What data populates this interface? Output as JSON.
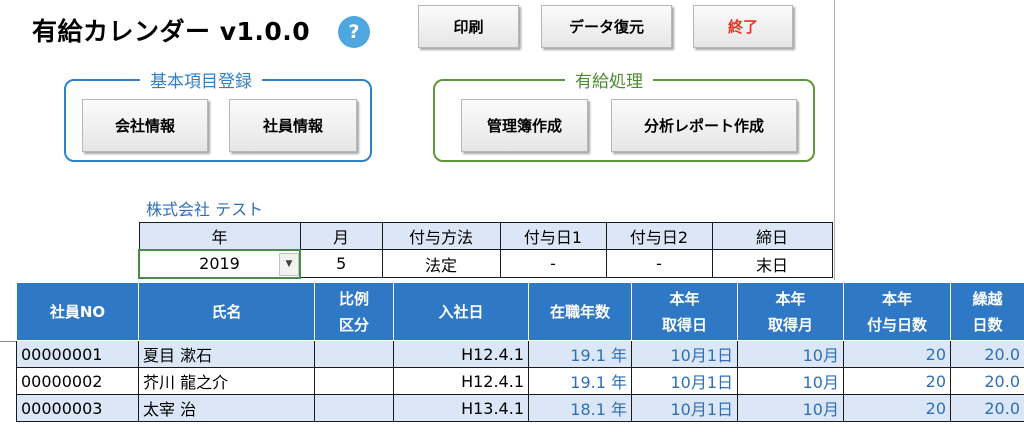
{
  "app": {
    "title": "有給カレンダー v1.0.0",
    "help": "?"
  },
  "toolbar": {
    "print": "印刷",
    "restore": "データ復元",
    "exit": "終了"
  },
  "groups": {
    "basic": {
      "title": "基本項目登録",
      "company_info": "会社情報",
      "employee_info": "社員情報"
    },
    "paid_leave": {
      "title": "有給処理",
      "ledger": "管理簿作成",
      "report": "分析レポート作成"
    }
  },
  "company": {
    "name": "株式会社 テスト"
  },
  "settings": {
    "headers": {
      "year": "年",
      "month": "月",
      "method": "付与方法",
      "grant1": "付与日1",
      "grant2": "付与日2",
      "closing": "締日"
    },
    "values": {
      "year": "2019",
      "month": "5",
      "method": "法定",
      "grant1": "-",
      "grant2": "-",
      "closing": "末日"
    }
  },
  "employee_table": {
    "headers": {
      "no": "社員NO",
      "name": "氏名",
      "ratio1": "比例",
      "ratio2": "区分",
      "joined": "入社日",
      "tenure": "在職年数",
      "acq_day1": "本年",
      "acq_day2": "取得日",
      "acq_month1": "本年",
      "acq_month2": "取得月",
      "grant_days1": "本年",
      "grant_days2": "付与日数",
      "carry1": "繰越",
      "carry2": "日数"
    },
    "rows": [
      {
        "no": "00000001",
        "name": "夏目 漱石",
        "ratio": "",
        "joined": "H12.4.1",
        "tenure": "19.1 年",
        "acq_day": "10月1日",
        "acq_month": "10月",
        "grant_days": "20",
        "carry": "20.0"
      },
      {
        "no": "00000002",
        "name": "芥川 龍之介",
        "ratio": "",
        "joined": "H12.4.1",
        "tenure": "19.1 年",
        "acq_day": "10月1日",
        "acq_month": "10月",
        "grant_days": "20",
        "carry": "20.0"
      },
      {
        "no": "00000003",
        "name": "太宰 治",
        "ratio": "",
        "joined": "H13.4.1",
        "tenure": "18.1 年",
        "acq_day": "10月1日",
        "acq_month": "10月",
        "grant_days": "20",
        "carry": "20.0"
      }
    ]
  }
}
